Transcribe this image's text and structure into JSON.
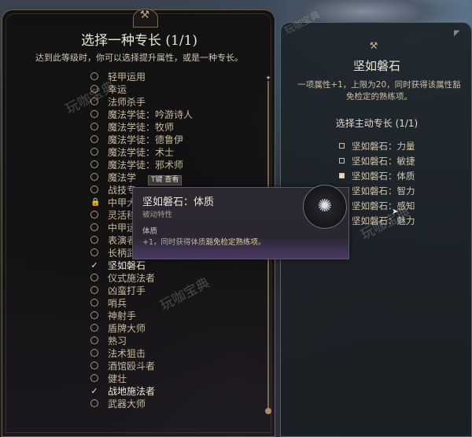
{
  "left_panel": {
    "title": "选择一种专长 (1/1)",
    "subtitle": "达到此等级时，你可以选择提升属性，或是一种专长。",
    "items": [
      {
        "label": "轻甲运用",
        "state": "radio"
      },
      {
        "label": "幸运",
        "state": "radio"
      },
      {
        "label": "法师杀手",
        "state": "radio"
      },
      {
        "label": "魔法学徒：吟游诗人",
        "state": "radio"
      },
      {
        "label": "魔法学徒：牧师",
        "state": "radio"
      },
      {
        "label": "魔法学徒：德鲁伊",
        "state": "radio"
      },
      {
        "label": "魔法学徒：术士",
        "state": "radio"
      },
      {
        "label": "魔法学徒：邪术师",
        "state": "radio"
      },
      {
        "label": "魔法学",
        "state": "radio"
      },
      {
        "label": "战技专",
        "state": "radio"
      },
      {
        "label": "中甲大",
        "state": "lock"
      },
      {
        "label": "灵活移",
        "state": "radio"
      },
      {
        "label": "中甲运",
        "state": "radio"
      },
      {
        "label": "表演者",
        "state": "radio"
      },
      {
        "label": "长柄武器大师",
        "state": "radio"
      },
      {
        "label": "坚如磐石",
        "state": "check"
      },
      {
        "label": "仪式施法者",
        "state": "radio"
      },
      {
        "label": "凶蛮打手",
        "state": "radio"
      },
      {
        "label": "哨兵",
        "state": "radio"
      },
      {
        "label": "神射手",
        "state": "radio"
      },
      {
        "label": "盾牌大师",
        "state": "radio"
      },
      {
        "label": "熟习",
        "state": "radio"
      },
      {
        "label": "法术狙击",
        "state": "radio"
      },
      {
        "label": "酒馆殴斗者",
        "state": "radio"
      },
      {
        "label": "健壮",
        "state": "radio"
      },
      {
        "label": "战地施法者",
        "state": "check"
      },
      {
        "label": "武器大师",
        "state": "radio"
      }
    ],
    "tip_tag": "T键 查看"
  },
  "right_panel": {
    "title": "坚如磐石",
    "description": "一项属性+1，上限为20，同时获得该属性豁免检定的熟练项。",
    "choose_label": "选择主动专长 (1/1)",
    "options": [
      {
        "label": "坚如磐石：力量",
        "selected": false
      },
      {
        "label": "坚如磐石：敏捷",
        "selected": false
      },
      {
        "label": "坚如磐石：体质",
        "selected": true
      },
      {
        "label": "坚如磐石：智力",
        "selected": false
      },
      {
        "label": "坚如磐石：感知",
        "selected": false
      },
      {
        "label": "坚如磐石：魅力",
        "selected": false
      }
    ]
  },
  "tooltip": {
    "title": "坚如磐石：体质",
    "type": "被动特性",
    "section": "体质",
    "body_prefix": "+1，同时获得体质",
    "body_highlight": "豁免检定熟练项",
    "body_suffix": "。"
  },
  "watermark": "玩咖宝典",
  "colors": {
    "accent": "#b9a27f",
    "selected": "#e6dcc5"
  }
}
